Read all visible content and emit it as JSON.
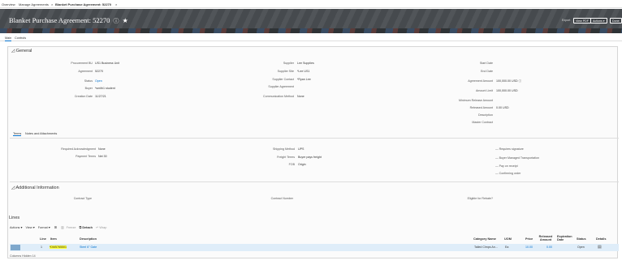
{
  "tabs": [
    "Overview",
    "Manage Agreements",
    "Blanket Purchase Agreement: 52270"
  ],
  "header": {
    "title": "Blanket Purchase Agreement: 52270",
    "buttons": [
      "Export",
      "View PDF",
      "Actions",
      "Done"
    ]
  },
  "subtabs": [
    "Main",
    "Controls"
  ],
  "general": {
    "title": "General",
    "left": [
      {
        "label": "Procurement BU",
        "value": "US1 Business Unit"
      },
      {
        "label": "Agreement",
        "value": "52270"
      },
      {
        "label": "Status",
        "value": "Open"
      },
      {
        "label": "Buyer",
        "value": "*smith1 student"
      },
      {
        "label": "Creation Date",
        "value": "11/27/21"
      }
    ],
    "middle": [
      {
        "label": "Supplier",
        "value": "Lee Supplies"
      },
      {
        "label": "Supplier Site",
        "value": "*Lee US1"
      },
      {
        "label": "Supplier Contact",
        "value": "*Ryan Lee"
      },
      {
        "label": "Supplier Agreement",
        "value": ""
      },
      {
        "label": "Communication Method",
        "value": "None"
      }
    ],
    "right": [
      {
        "label": "Start Date",
        "value": ""
      },
      {
        "label": "End Date",
        "value": ""
      },
      {
        "label": "Agreement Amount",
        "value": "100,000.00 USD"
      },
      {
        "label": "Amount Limit",
        "value": "100,000.00 USD"
      },
      {
        "label": "Minimum Release Amount",
        "value": ""
      },
      {
        "label": "Released Amount",
        "value": "0.00 USD"
      },
      {
        "label": "Description",
        "value": ""
      },
      {
        "label": "Master Contract",
        "value": ""
      }
    ]
  },
  "terms_tabs": [
    "Terms",
    "Notes and Attachments"
  ],
  "terms": {
    "left": [
      {
        "label": "Required Acknowledgment",
        "value": "None"
      },
      {
        "label": "Payment Terms",
        "value": "Net 30"
      }
    ],
    "middle": [
      {
        "label": "Shipping Method",
        "value": "UPS"
      },
      {
        "label": "Freight Terms",
        "value": "Buyer pays freight"
      },
      {
        "label": "FOB",
        "value": "Origin"
      }
    ],
    "checks": [
      "Requires signature",
      "Buyer Managed Transportation",
      "Pay on receipt",
      "Confirming order"
    ]
  },
  "additional": {
    "title": "Additional Information",
    "fields": [
      "Contract Type",
      "Contract Number",
      "Eligible for Rebate?"
    ]
  },
  "lines": {
    "title": "Lines",
    "toolbar": [
      "Actions",
      "View",
      "Format",
      "Freeze",
      "Detach",
      "Wrap"
    ],
    "columns": [
      "Line",
      "Item",
      "Description",
      "Category Name",
      "UOM",
      "Price",
      "Released Amount",
      "Expiration Date",
      "Status",
      "Details"
    ],
    "rows": [
      {
        "line": "1",
        "item": "*DM5765501",
        "description": "Steel 6\" Gate",
        "category": "Tailed Clmps An...",
        "uom": "Ea",
        "price": "10.00",
        "released": "0.00",
        "expiration": "",
        "status": "Open"
      }
    ],
    "footer": "Columns Hidden  14"
  }
}
